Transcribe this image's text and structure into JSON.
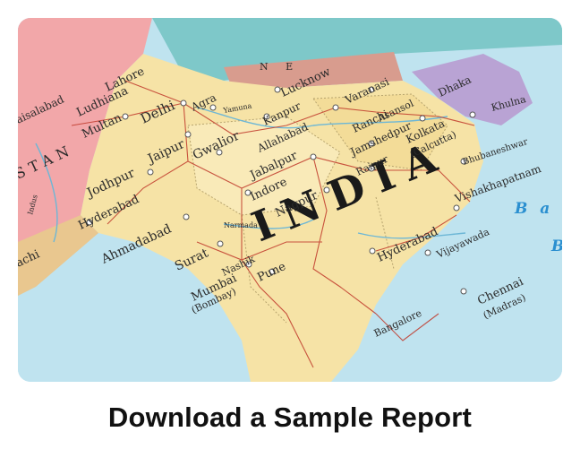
{
  "cta": {
    "label": "Download a Sample Report"
  },
  "map": {
    "country_label": "INDIA",
    "sea_label": "B a",
    "sea_label_2": "B",
    "country_top_left": "STAN",
    "country_top": "N E",
    "cities": {
      "delhi": "Delhi",
      "agra": "Agra",
      "lucknow": "Lucknow",
      "kanpur": "Kanpur",
      "varanasi": "Varanasi",
      "allahabad": "Allahabad",
      "jaipur": "Jaipur",
      "gwalior": "Gwalior",
      "jodhpur": "Jodhpur",
      "jabalpur": "Jabalpur",
      "indore": "Indore",
      "nagpur": "Nagpur",
      "ranchi": "Ranchi",
      "jamshedpur": "Jamshedpur",
      "kolkata": "Kolkata",
      "calcutta": "(Calcutta)",
      "raipur": "Raipur",
      "bhubaneswar": "Bhubaneshwar",
      "vishakhapatnam": "Vishakhapatnam",
      "hyderabad_in": "Hyderabad",
      "vijayawada": "Vijayawada",
      "ahmadabad": "Ahmadabad",
      "surat": "Surat",
      "nashik": "Nashik",
      "pune": "Pune",
      "mumbai": "Mumbai",
      "bombay": "(Bombay)",
      "chennai": "Chennai",
      "madras": "(Madras)",
      "hyderabad_pk": "Hyderabad",
      "multan": "Multan",
      "ludhiana": "Ludhiana",
      "lahore": "Lahore",
      "faisalabad": "aisalabad",
      "karachi": "achi",
      "dhaka": "Dhaka",
      "khulna": "Khulna",
      "asansol": "Asansol",
      "bangalore": "Bangalore",
      "indus": "Indus",
      "narmada": "Narmada",
      "yamuna": "Yamuna"
    }
  }
}
